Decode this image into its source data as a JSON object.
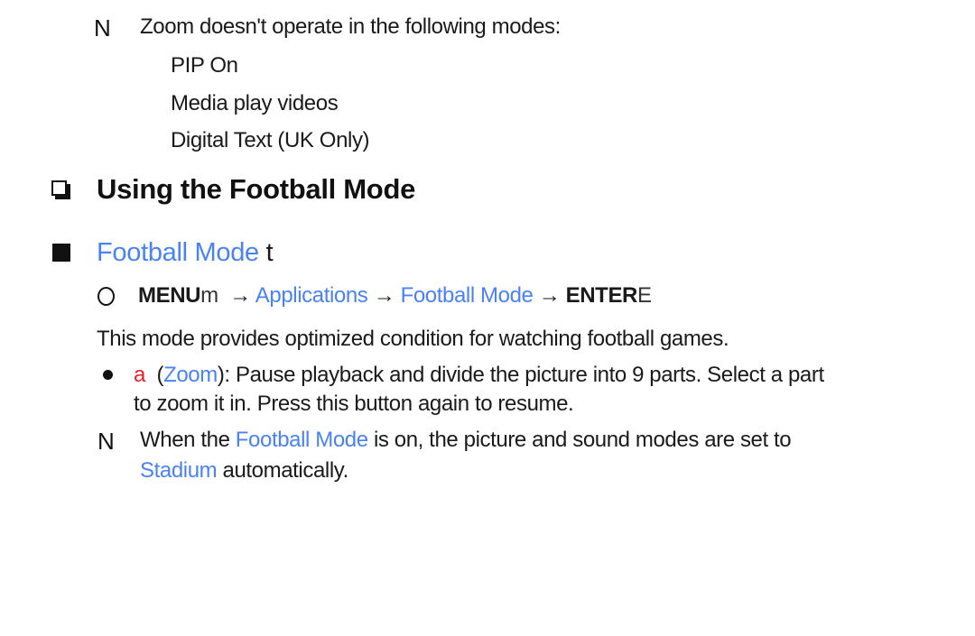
{
  "note1": {
    "marker": "N",
    "text": "Zoom doesn't operate in the following modes:",
    "modes": [
      "PIP On",
      "Media play videos",
      "Digital Text (UK Only)"
    ]
  },
  "section": {
    "title": "Using the Football Mode"
  },
  "subsection": {
    "title": "Football Mode",
    "suffix": "t"
  },
  "menu_path": {
    "menu_label": "MENU",
    "menu_suffix": "m",
    "arrow": "→",
    "step1": "Applications",
    "step2": "Football Mode",
    "enter_label": "ENTER",
    "enter_suffix": "E"
  },
  "description": "This mode provides optimized condition for watching football games.",
  "bullet": {
    "key_glyph": "a",
    "open_paren": "(",
    "key_name": "Zoom",
    "text_line1": "): Pause playback and divide the picture into 9 parts. Select a part",
    "text_line2": "to zoom it in. Press this button again to resume."
  },
  "note2": {
    "marker": "N",
    "prefix": "When the ",
    "highlight1": "Football Mode",
    "middle": " is on, the picture and sound modes are set to",
    "highlight2": "Stadium",
    "suffix": " automatically."
  },
  "colors": {
    "link_blue": "#4b82f2",
    "key_red": "#e8202a",
    "text": "#1a1a1a"
  }
}
